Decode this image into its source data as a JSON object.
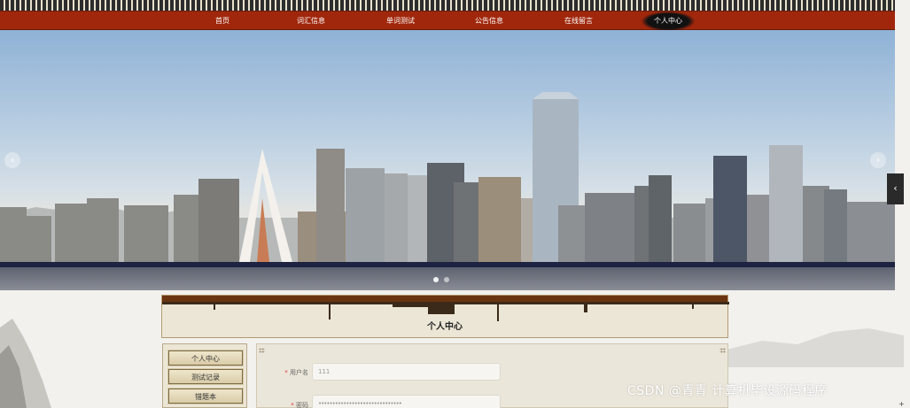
{
  "nav": {
    "items": [
      {
        "label": "首页"
      },
      {
        "label": "词汇信息"
      },
      {
        "label": "单词测试"
      },
      {
        "label": "公告信息"
      },
      {
        "label": "在线留言"
      },
      {
        "label": "个人中心"
      }
    ],
    "active": "个人中心"
  },
  "banner": {
    "prev_icon": "chevron-left-icon",
    "next_icon": "chevron-right-icon",
    "slide_index": 1,
    "slide_count": 2
  },
  "panel": {
    "title": "个人中心"
  },
  "side_menu": {
    "items": [
      {
        "label": "个人中心"
      },
      {
        "label": "测试记录"
      },
      {
        "label": "错题本"
      }
    ]
  },
  "form": {
    "username": {
      "label": "用户名",
      "value": "111"
    },
    "password": {
      "label": "密码",
      "value": "••••••••••••••••••••••••••••••"
    }
  },
  "watermark": {
    "text": "CSDN @青青  计算机毕设源码程序"
  },
  "colors": {
    "nav_bg": "#a0270c",
    "panel_bg": "#ece6d6",
    "required": "#dd3333"
  }
}
